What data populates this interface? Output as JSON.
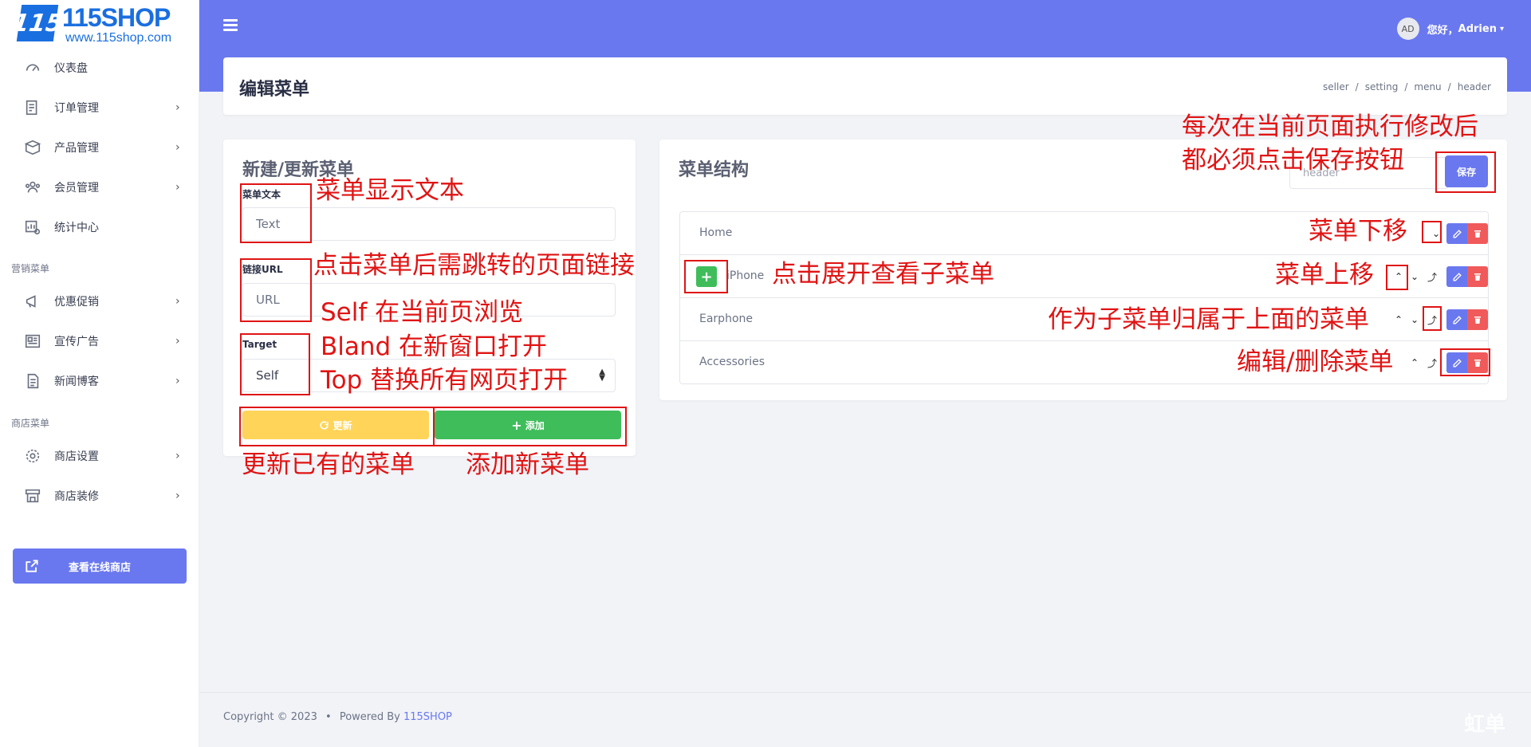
{
  "brand": {
    "logo_mark": "115",
    "name": "115SHOP",
    "url": "www.115shop.com"
  },
  "sidebar": {
    "items": [
      {
        "label": "仪表盘",
        "icon": "dashboard-icon",
        "arrow": ""
      },
      {
        "label": "订单管理",
        "icon": "order-icon",
        "arrow": "›"
      },
      {
        "label": "产品管理",
        "icon": "box-icon",
        "arrow": "›"
      },
      {
        "label": "会员管理",
        "icon": "users-icon",
        "arrow": "›"
      },
      {
        "label": "统计中心",
        "icon": "stats-icon",
        "arrow": ""
      }
    ],
    "section_marketing": "营销菜单",
    "marketing_items": [
      {
        "label": "优惠促销",
        "icon": "megaphone-icon",
        "arrow": "›"
      },
      {
        "label": "宣传广告",
        "icon": "newspaper-icon",
        "arrow": "›"
      },
      {
        "label": "新闻博客",
        "icon": "document-icon",
        "arrow": "›"
      }
    ],
    "section_store": "商店菜单",
    "store_items": [
      {
        "label": "商店设置",
        "icon": "gear-icon",
        "arrow": "›"
      },
      {
        "label": "商店装修",
        "icon": "storefront-icon",
        "arrow": "›"
      }
    ],
    "view_store_label": "查看在线商店"
  },
  "header": {
    "avatar_initials": "AD",
    "greeting": "您好，",
    "username": "Adrien",
    "caret": "▾"
  },
  "page": {
    "title": "编辑菜单",
    "breadcrumb": [
      "seller",
      "setting",
      "menu",
      "header"
    ]
  },
  "form": {
    "title": "新建/更新菜单",
    "text_label": "菜单文本",
    "text_placeholder": "Text",
    "url_label": "链接URL",
    "url_placeholder": "URL",
    "target_label": "Target",
    "target_value": "Self",
    "update_label": "更新",
    "add_label": "添加"
  },
  "structure": {
    "title": "菜单结构",
    "menu_select_value": "header",
    "save_label": "保存",
    "rows": [
      {
        "label": "Home"
      },
      {
        "label": "iPhone"
      },
      {
        "label": "Earphone"
      },
      {
        "label": "Accessories"
      }
    ]
  },
  "footer": {
    "copyright": "Copyright © 2023",
    "dot": "•",
    "powered_by": "Powered By",
    "brand": "115SHOP"
  },
  "watermark": "虹单",
  "annotations": {
    "menu_text": "菜单显示文本",
    "link_url": "点击菜单后需跳转的页面链接",
    "target_self": "Self 在当前页浏览",
    "target_blank": "Bland 在新窗口打开",
    "target_top": "Top 替换所有网页打开",
    "update_existing": "更新已有的菜单",
    "add_new": "添加新菜单",
    "save_note_1": "每次在当前页面执行修改后",
    "save_note_2": "都必须点击保存按钮",
    "move_down": "菜单下移",
    "expand": "点击展开查看子菜单",
    "move_up": "菜单上移",
    "indent": "作为子菜单归属于上面的菜单",
    "edit_delete": "编辑/删除菜单"
  },
  "colors": {
    "primary": "#6a78ef",
    "success": "#3fbd5b",
    "warning": "#ffd459",
    "danger": "#f05a5a",
    "annotation": "#e01414"
  }
}
